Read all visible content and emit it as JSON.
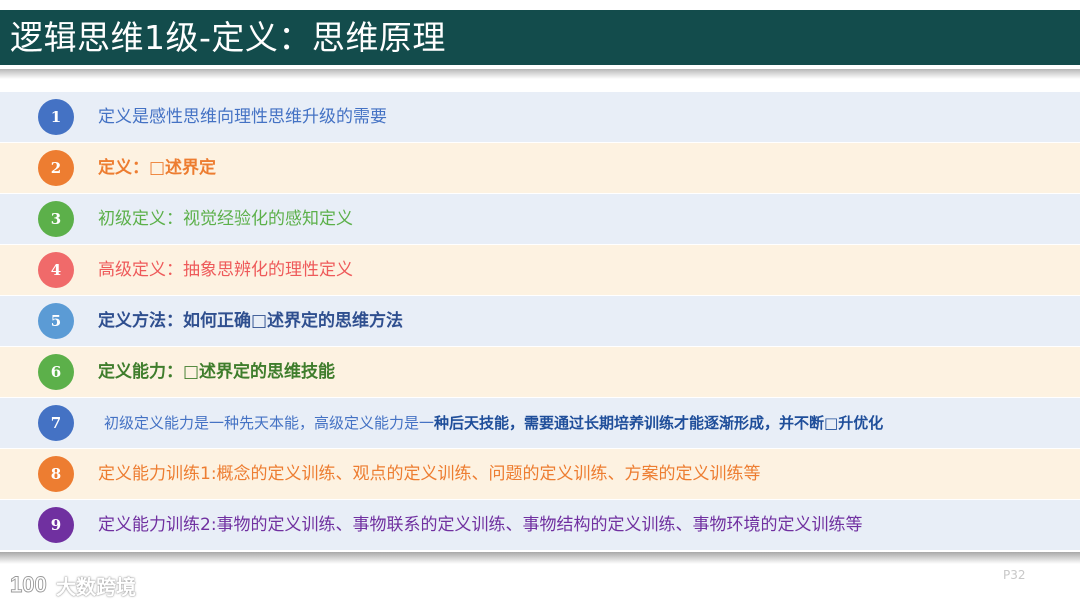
{
  "header": {
    "title": "逻辑思维1级-定义：思维原理"
  },
  "items": [
    {
      "num": "1",
      "text": "定义是感性思维向理性思维升级的需要",
      "num_color": "#4472c4",
      "text_color": "#4472c4",
      "bg": "#e8eef7"
    },
    {
      "num": "2",
      "text": "定义：□述界定",
      "num_color": "#ed7d31",
      "text_color": "#ed7d31",
      "bg": "#fdf2e1"
    },
    {
      "num": "3",
      "text": "初级定义：视觉经验化的感知定义",
      "num_color": "#5cb04a",
      "text_color": "#5cb04a",
      "bg": "#e8eef7"
    },
    {
      "num": "4",
      "text": "高级定义：抽象思辨化的理性定义",
      "num_color": "#f06a6a",
      "text_color": "#ee5a5a",
      "bg": "#fdf2e1"
    },
    {
      "num": "5",
      "text": "定义方法：如何正确□述界定的思维方法",
      "num_color": "#5b9bd5",
      "text_color": "#2f4f8f",
      "bg": "#e8eef7"
    },
    {
      "num": "6",
      "text": "定义能力：□述界定的思维技能",
      "num_color": "#5cb04a",
      "text_color": "#3f7d2c",
      "bg": "#fdf2e1"
    },
    {
      "num": "7",
      "text_a": "初级定义能力是一种先天本能，高级定义能力是一",
      "text_b": "种后天技能，需要通过长期培养训练才能逐渐形成，并不断□升优化",
      "num_color": "#4472c4",
      "text_color": "#4472c4",
      "text_b_color": "#1f4e9a",
      "bg": "#e8eef7"
    },
    {
      "num": "8",
      "text": "定义能力训练1:概念的定义训练、观点的定义训练、问题的定义训练、方案的定义训练等",
      "num_color": "#ed7d31",
      "text_color": "#ed7d31",
      "bg": "#fdf2e1"
    },
    {
      "num": "9",
      "text": "定义能力训练2:事物的定义训练、事物联系的定义训练、事物结构的定义训练、事物环境的定义训练等",
      "num_color": "#7030a0",
      "text_color": "#7030a0",
      "bg": "#e8eef7"
    }
  ],
  "footer": {
    "page": "P32",
    "watermark": "大数跨境",
    "watermark_logo": "100-logo"
  }
}
